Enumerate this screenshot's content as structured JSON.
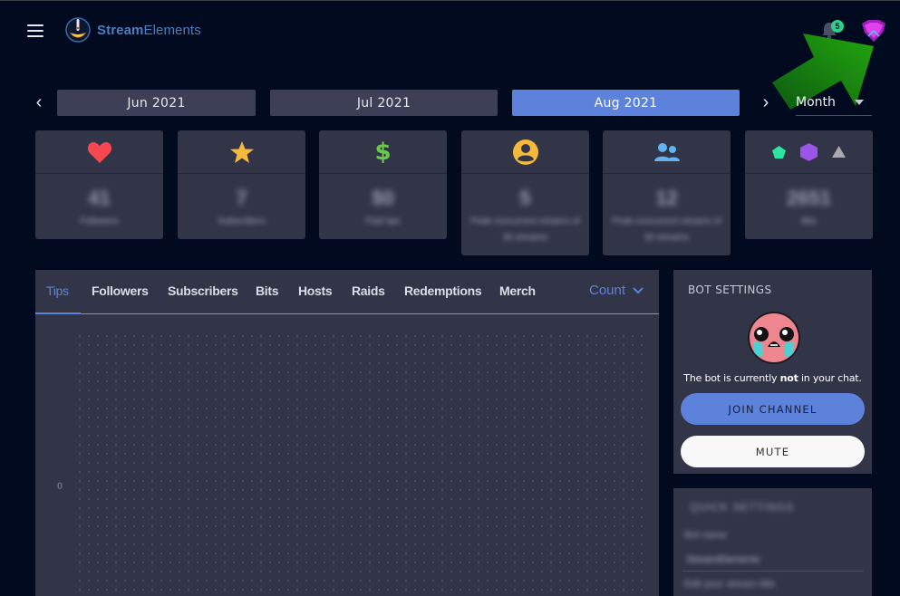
{
  "app": {
    "logo_bold": "Stream",
    "logo_light": "Elements"
  },
  "header": {
    "notification_count": "5",
    "menu_icon": "hamburger-icon",
    "bell_icon": "bell-icon",
    "avatar_icon": "user-avatar"
  },
  "date_nav": {
    "prev_icon": "‹",
    "next_icon": "›",
    "months": [
      "Jun 2021",
      "Jul 2021",
      "Aug 2021"
    ],
    "active_month": "Aug 2021",
    "period": "Month"
  },
  "stats": [
    {
      "icon": "heart-icon",
      "color": "#f5484e",
      "value": "41",
      "label": "Followers"
    },
    {
      "icon": "star-icon",
      "color": "#f6b93b",
      "value": "7",
      "label": "Subscribers"
    },
    {
      "icon": "dollar-icon",
      "color": "#6ac94a",
      "value": "$0",
      "label": "Paid tips"
    },
    {
      "icon": "user-circle-icon",
      "color": "#f6b93b",
      "value": "5",
      "label": "Peak concurrent viewers of 30 streams"
    },
    {
      "icon": "users-icon",
      "color": "#5eb5f0",
      "value": "12",
      "label": "Peak concurrent viewers of 30 streams"
    },
    {
      "icon": "gems-icon",
      "color": "#2fe3a0",
      "value": "2651",
      "label": "Bits"
    }
  ],
  "chart_panel": {
    "tabs": [
      "Tips",
      "Followers",
      "Subscribers",
      "Bits",
      "Hosts",
      "Raids",
      "Redemptions",
      "Merch"
    ],
    "active_tab": "Tips",
    "metric_select": "Count",
    "y_tick": "0"
  },
  "bot_settings": {
    "title": "BOT SETTINGS",
    "status_prefix": "The bot is currently ",
    "status_emphasis": "not",
    "status_suffix": " in your chat.",
    "join_label": "JOIN CHANNEL",
    "mute_label": "MUTE"
  },
  "quotes_panel": {
    "title": "QUICK SETTINGS",
    "line1": "Bot name",
    "line2": "StreamElements",
    "line3": "Edit your stream title"
  },
  "colors": {
    "accent": "#5c82dc",
    "background": "#020a1f",
    "panel": "#323447",
    "annotation_arrow": "#1fa80f"
  }
}
